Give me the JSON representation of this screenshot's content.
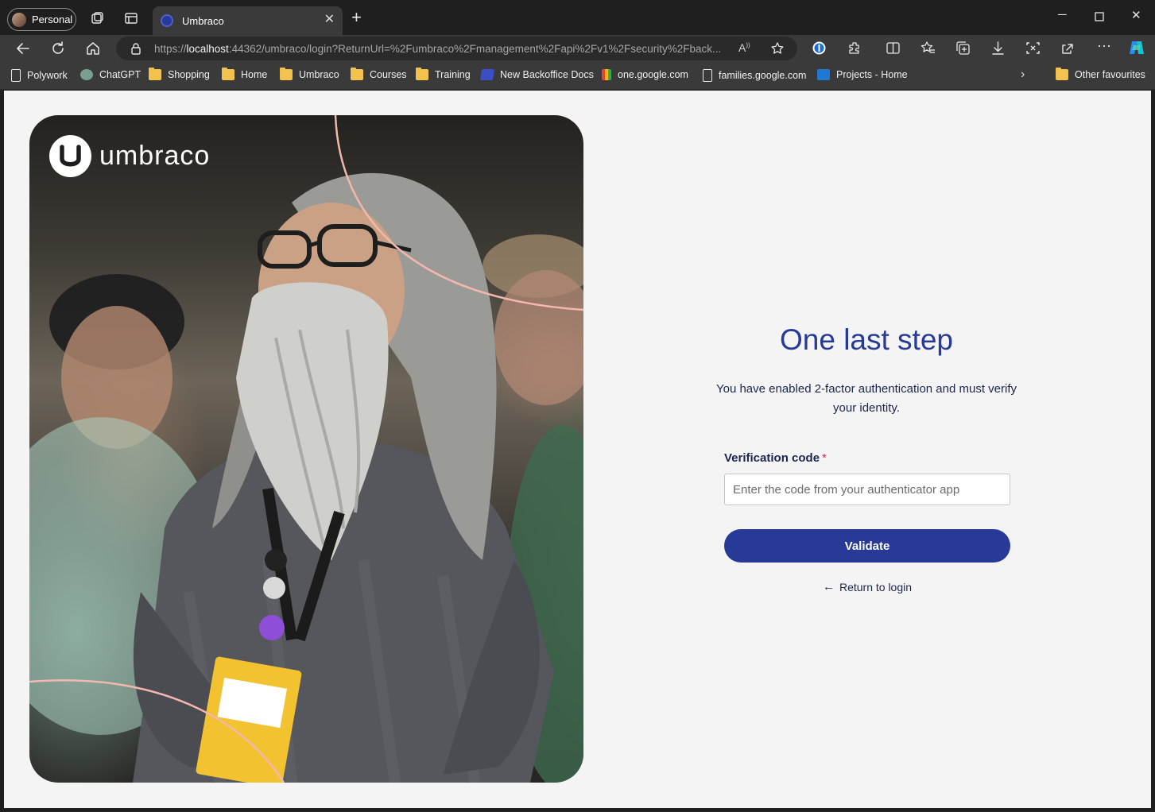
{
  "browser": {
    "profile_label": "Personal",
    "tab_title": "Umbraco",
    "url_host": "localhost",
    "url_prefix": "https://",
    "url_rest": ":44362/umbraco/login?ReturnUrl=%2Fumbraco%2Fmanagement%2Fapi%2Fv1%2Fsecurity%2Fback..."
  },
  "bookmarks": [
    {
      "label": "Polywork",
      "icon": "page-icon"
    },
    {
      "label": "ChatGPT",
      "icon": "chatgpt-icon"
    },
    {
      "label": "Shopping",
      "icon": "folder-icon"
    },
    {
      "label": "Home",
      "icon": "folder-icon"
    },
    {
      "label": "Umbraco",
      "icon": "folder-icon"
    },
    {
      "label": "Courses",
      "icon": "folder-icon"
    },
    {
      "label": "Training",
      "icon": "folder-icon"
    },
    {
      "label": "New Backoffice Docs",
      "icon": "docs-icon"
    },
    {
      "label": "one.google.com",
      "icon": "google-one-icon"
    },
    {
      "label": "families.google.com",
      "icon": "page-icon"
    },
    {
      "label": "Projects - Home",
      "icon": "azure-devops-icon"
    }
  ],
  "other_favourites": "Other favourites",
  "brand": {
    "name": "umbraco"
  },
  "login": {
    "title": "One last step",
    "subtitle": "You have enabled 2-factor authentication and must verify your identity.",
    "code_label": "Verification code",
    "required_mark": "*",
    "code_placeholder": "Enter the code from your authenticator app",
    "code_value": "",
    "validate_label": "Validate",
    "return_label": "Return to login"
  },
  "colors": {
    "accent": "#283a97",
    "text": "#1b264f",
    "required": "#d42054",
    "page_bg": "#f4f4f4"
  }
}
